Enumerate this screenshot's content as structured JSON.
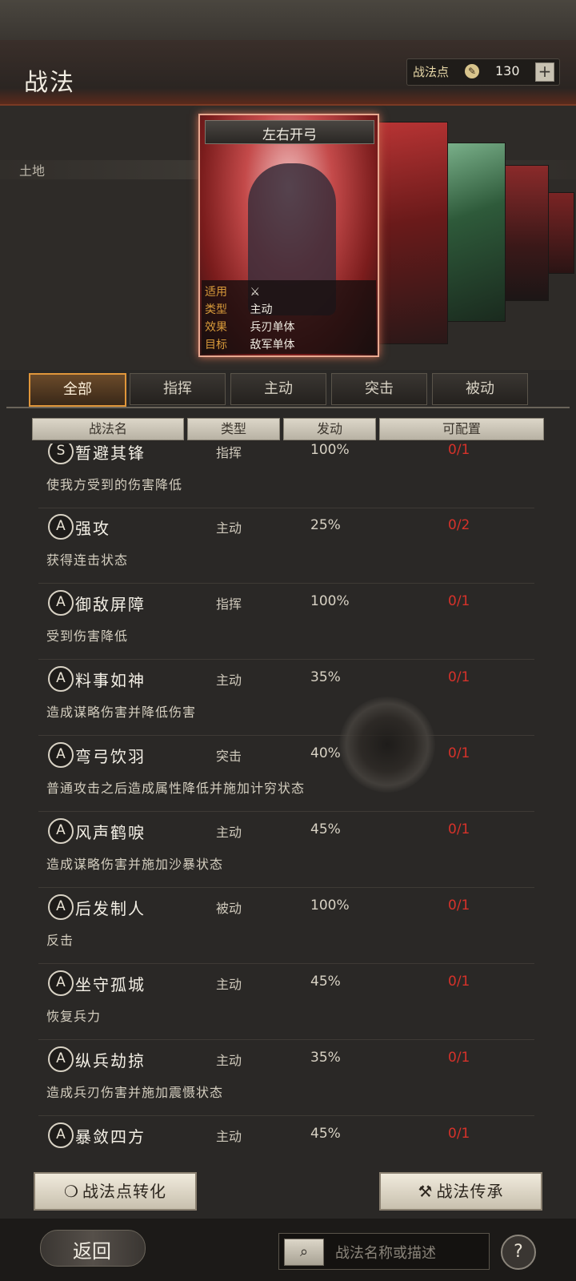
{
  "header": {
    "title": "战法",
    "points_label": "战法点",
    "points_icon": "brush-icon",
    "points_value": "130",
    "add_label": "+"
  },
  "hero": {
    "land_label": "土地",
    "card": {
      "title": "左右开弓",
      "rows": [
        {
          "key": "适用",
          "val": ""
        },
        {
          "key": "类型",
          "val": "主动"
        },
        {
          "key": "效果",
          "val": "兵刃单体"
        },
        {
          "key": "目标",
          "val": "敌军单体"
        }
      ]
    }
  },
  "tabs": [
    "全部",
    "指挥",
    "主动",
    "突击",
    "被动"
  ],
  "active_tab": 0,
  "columns": [
    "战法名",
    "类型",
    "发动",
    "可配置"
  ],
  "skills": [
    {
      "grade": "S",
      "name": "暂避其锋",
      "type": "指挥",
      "rate": "100%",
      "alloc": "0/1",
      "desc": "使我方受到的伤害降低"
    },
    {
      "grade": "A",
      "name": "强攻",
      "type": "主动",
      "rate": "25%",
      "alloc": "0/2",
      "desc": "获得连击状态"
    },
    {
      "grade": "A",
      "name": "御敌屏障",
      "type": "指挥",
      "rate": "100%",
      "alloc": "0/1",
      "desc": "受到伤害降低"
    },
    {
      "grade": "A",
      "name": "料事如神",
      "type": "主动",
      "rate": "35%",
      "alloc": "0/1",
      "desc": "造成谋略伤害并降低伤害"
    },
    {
      "grade": "A",
      "name": "弯弓饮羽",
      "type": "突击",
      "rate": "40%",
      "alloc": "0/1",
      "desc": "普通攻击之后造成属性降低并施加计穷状态"
    },
    {
      "grade": "A",
      "name": "风声鹤唳",
      "type": "主动",
      "rate": "45%",
      "alloc": "0/1",
      "desc": "造成谋略伤害并施加沙暴状态"
    },
    {
      "grade": "A",
      "name": "后发制人",
      "type": "被动",
      "rate": "100%",
      "alloc": "0/1",
      "desc": "反击"
    },
    {
      "grade": "A",
      "name": "坐守孤城",
      "type": "主动",
      "rate": "45%",
      "alloc": "0/1",
      "desc": "恢复兵力"
    },
    {
      "grade": "A",
      "name": "纵兵劫掠",
      "type": "主动",
      "rate": "35%",
      "alloc": "0/1",
      "desc": "造成兵刃伤害并施加震慑状态"
    },
    {
      "grade": "A",
      "name": "暴敛四方",
      "type": "主动",
      "rate": "45%",
      "alloc": "0/1",
      "desc": ""
    }
  ],
  "footer": {
    "convert_label": "战法点转化",
    "inherit_label": "战法传承"
  },
  "nav": {
    "back_label": "返回",
    "search_placeholder": "战法名称或描述",
    "help_label": "?"
  },
  "colors": {
    "accent": "#e0963a",
    "alloc_red": "#d6322a",
    "card_red": "#c44a4a"
  }
}
